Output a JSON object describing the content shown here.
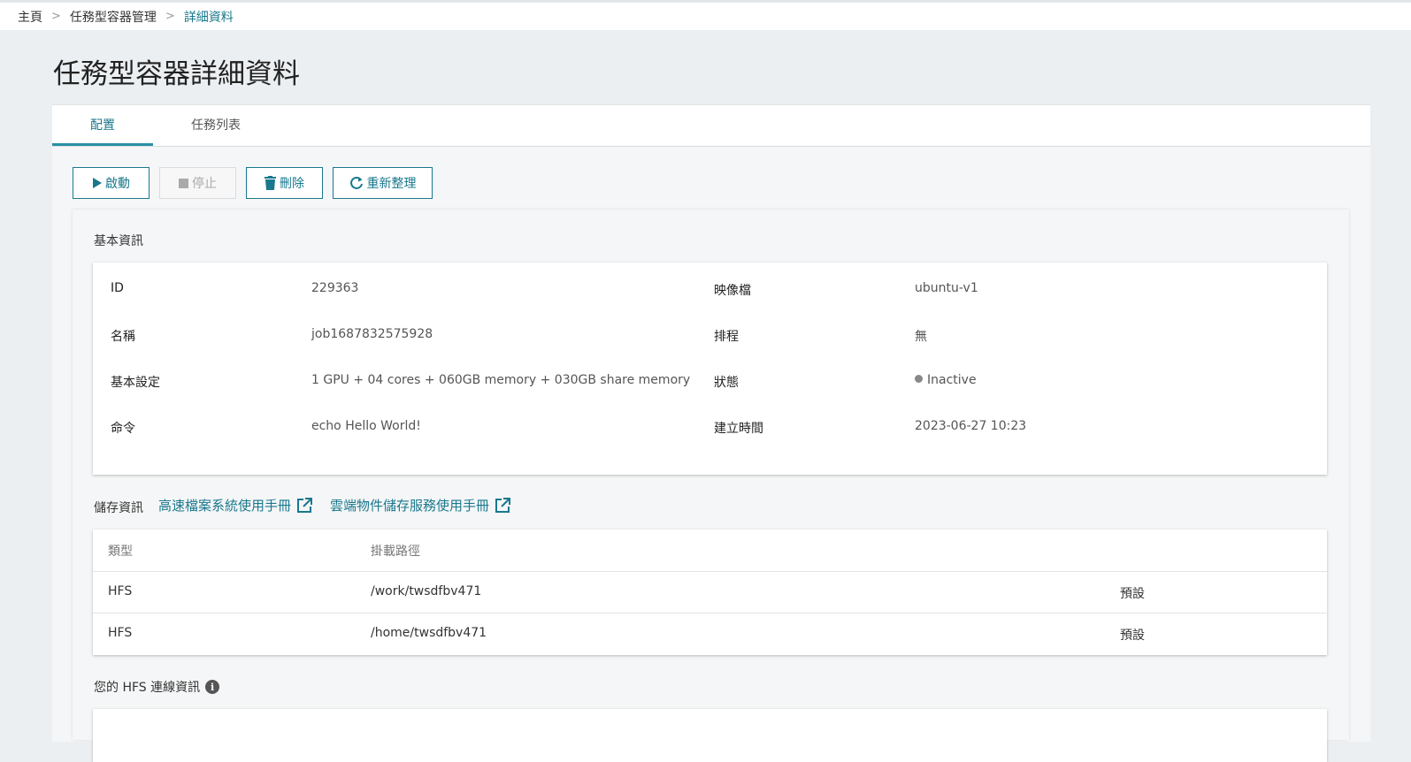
{
  "breadcrumb": {
    "items": [
      "主頁",
      "任務型容器管理",
      "詳細資料"
    ],
    "separator": ">"
  },
  "page": {
    "title": "任務型容器詳細資料"
  },
  "tabs": [
    {
      "label": "配置",
      "active": true
    },
    {
      "label": "任務列表",
      "active": false
    }
  ],
  "toolbar": {
    "start_label": "啟動",
    "stop_label": "停止",
    "delete_label": "刪除",
    "refresh_label": "重新整理"
  },
  "basic_info": {
    "section_title": "基本資訊",
    "rows": [
      {
        "left_key": "ID",
        "left_value": "229363",
        "right_key": "映像檔",
        "right_value": "ubuntu-v1"
      },
      {
        "left_key": "名稱",
        "left_value": "job1687832575928",
        "right_key": "排程",
        "right_value": "無"
      },
      {
        "left_key": "基本設定",
        "left_value": "1 GPU + 04 cores + 060GB memory + 030GB share memory",
        "right_key": "狀態",
        "right_value": "Inactive"
      },
      {
        "left_key": "命令",
        "left_value": "echo Hello World!",
        "right_key": "建立時間",
        "right_value": "2023-06-27 10:23"
      }
    ]
  },
  "storage": {
    "section_title": "儲存資訊",
    "links": [
      "高速檔案系統使用手冊",
      "雲端物件儲存服務使用手冊"
    ],
    "columns": [
      "類型",
      "掛載路徑",
      ""
    ],
    "rows": [
      {
        "type": "HFS",
        "path": "/work/twsdfbv471",
        "tag": "預設"
      },
      {
        "type": "HFS",
        "path": "/home/twsdfbv471",
        "tag": "預設"
      }
    ]
  },
  "hfs_connection": {
    "title": "您的 HFS 連線資訊"
  },
  "colors": {
    "accent": "#19788d",
    "tab_underline": "#2a90a6",
    "background": "#eceff1",
    "status_inactive": "#888888"
  }
}
